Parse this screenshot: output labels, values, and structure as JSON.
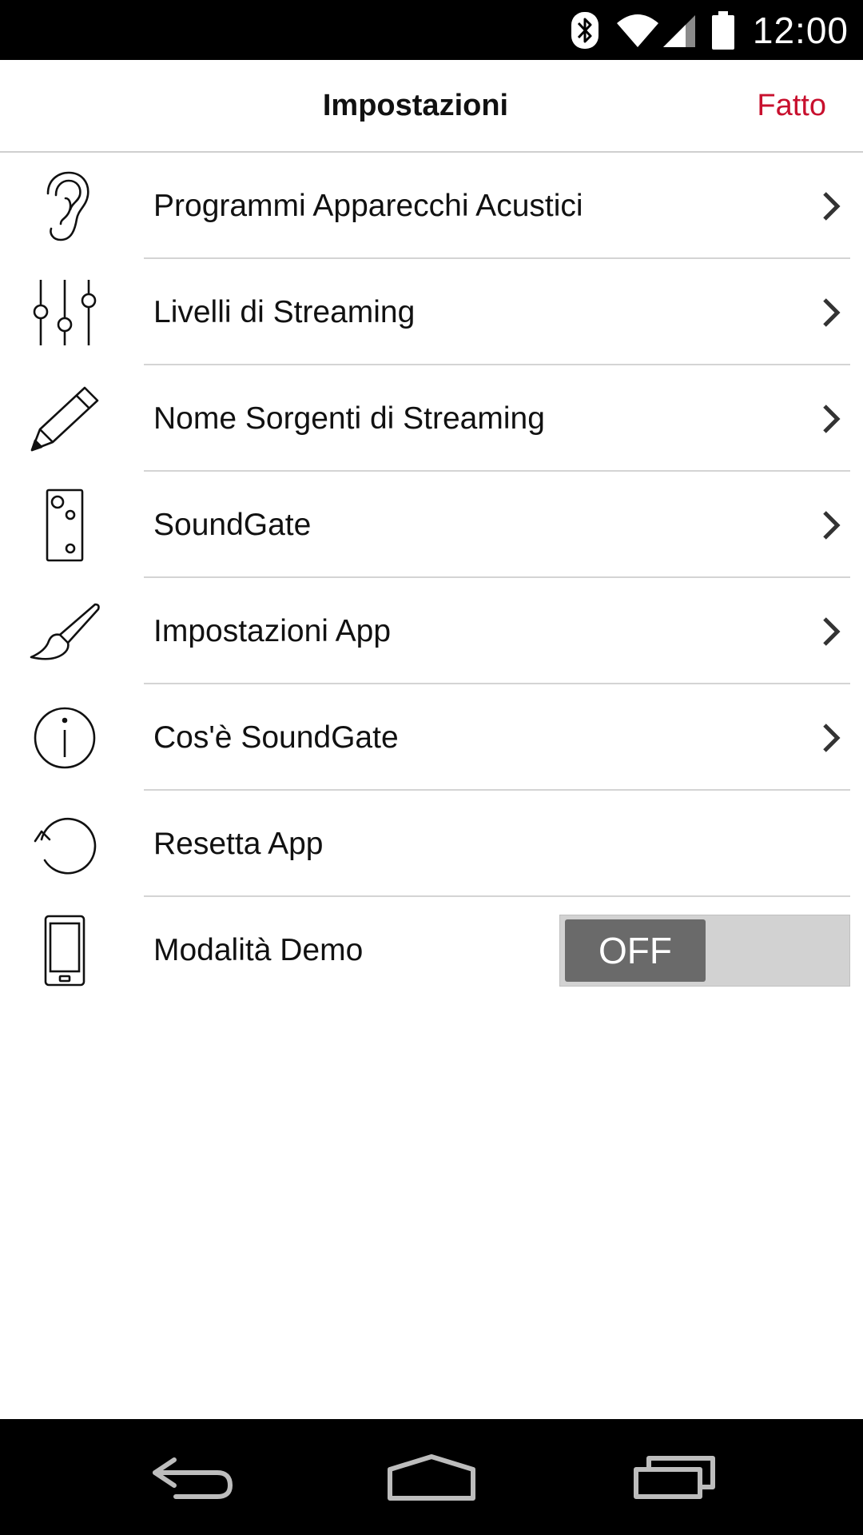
{
  "status_bar": {
    "time": "12:00",
    "icons": [
      "bluetooth-icon",
      "wifi-icon",
      "signal-icon",
      "battery-icon"
    ]
  },
  "header": {
    "title": "Impostazioni",
    "done_label": "Fatto"
  },
  "colors": {
    "accent": "#c8102e",
    "divider": "#d4d4d4",
    "toggle_track": "#d2d2d2",
    "toggle_knob": "#6a6a6a"
  },
  "settings": {
    "items": [
      {
        "label": "Programmi Apparecchi Acustici",
        "icon": "ear-icon",
        "chevron": true
      },
      {
        "label": "Livelli di Streaming",
        "icon": "sliders-icon",
        "chevron": true
      },
      {
        "label": "Nome Sorgenti di Streaming",
        "icon": "pencil-icon",
        "chevron": true
      },
      {
        "label": "SoundGate",
        "icon": "soundgate-device-icon",
        "chevron": true
      },
      {
        "label": "Impostazioni App",
        "icon": "paintbrush-icon",
        "chevron": true
      },
      {
        "label": "Cos'è SoundGate",
        "icon": "info-icon",
        "chevron": true
      },
      {
        "label": "Resetta App",
        "icon": "reset-icon",
        "chevron": false
      },
      {
        "label": "Modalità Demo",
        "icon": "phone-icon",
        "toggle": "OFF"
      }
    ]
  },
  "nav_bar": {
    "buttons": [
      "back-icon",
      "home-icon",
      "recents-icon"
    ]
  }
}
